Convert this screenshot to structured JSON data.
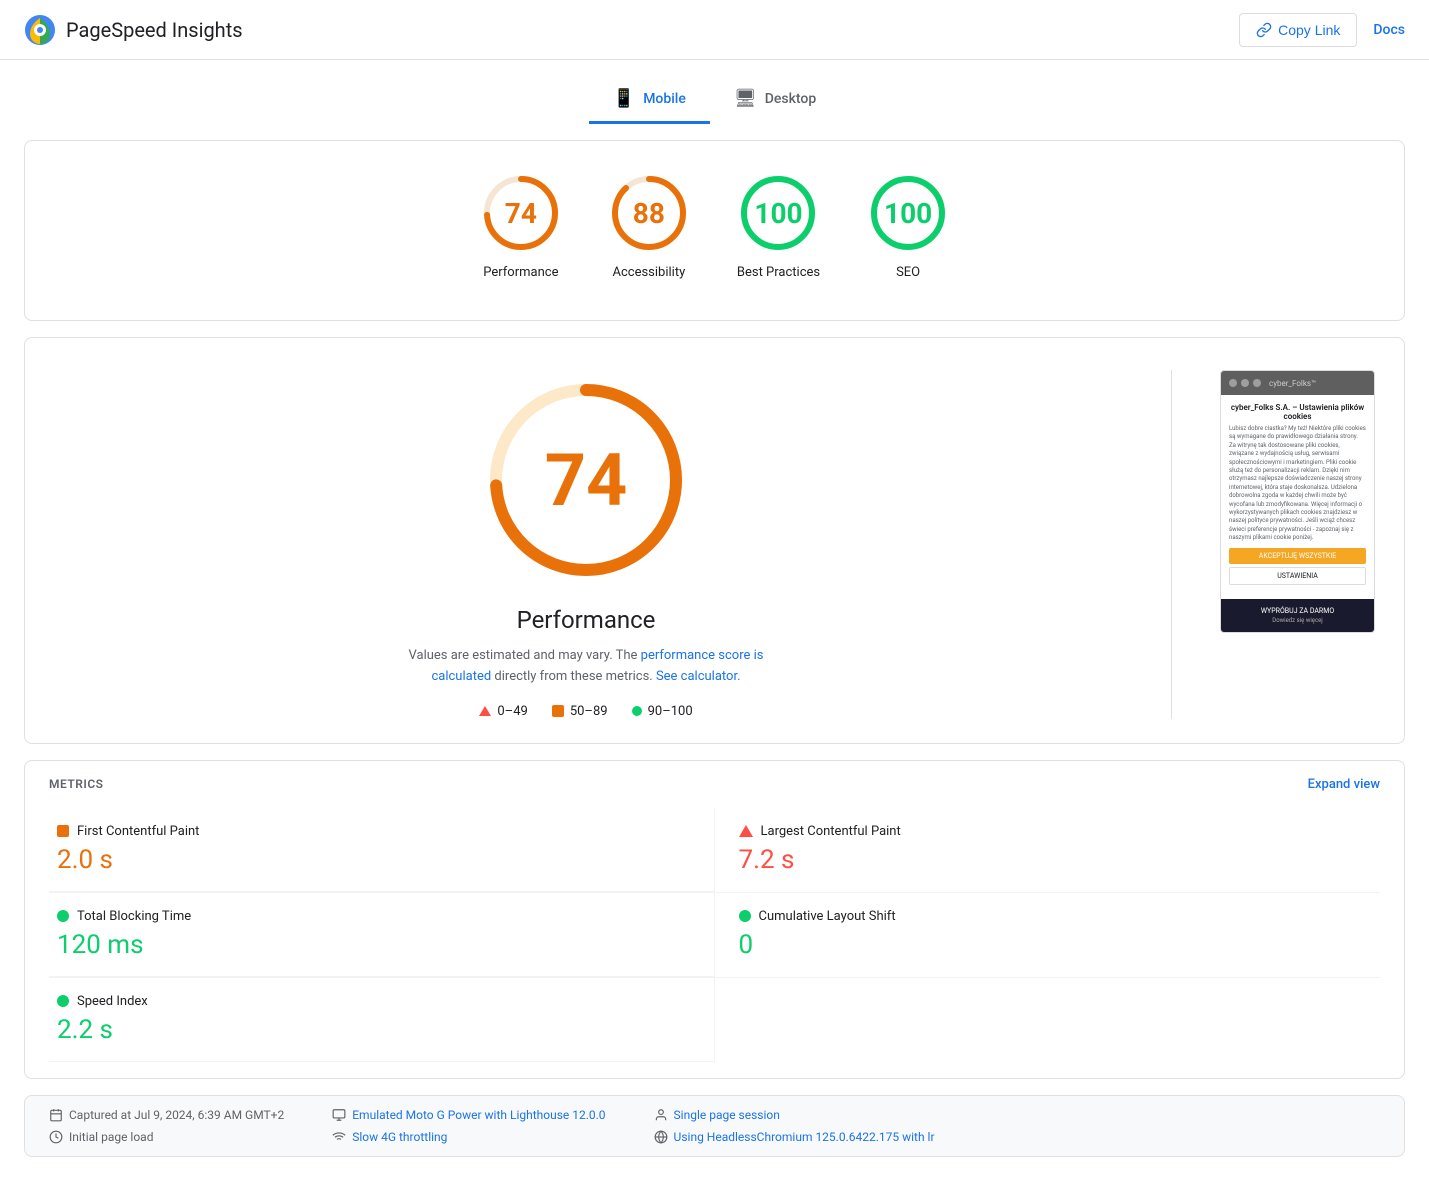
{
  "header": {
    "title": "PageSpeed Insights",
    "copy_link_label": "Copy Link",
    "docs_label": "Docs"
  },
  "tabs": {
    "mobile_label": "Mobile",
    "desktop_label": "Desktop"
  },
  "scores": [
    {
      "id": "performance",
      "value": 74,
      "label": "Performance",
      "color": "orange",
      "stroke": "#e8710a"
    },
    {
      "id": "accessibility",
      "value": 88,
      "label": "Accessibility",
      "color": "orange",
      "stroke": "#e8710a"
    },
    {
      "id": "best-practices",
      "value": 100,
      "label": "Best Practices",
      "color": "green",
      "stroke": "#0cce6b"
    },
    {
      "id": "seo",
      "value": 100,
      "label": "SEO",
      "color": "green",
      "stroke": "#0cce6b"
    }
  ],
  "performance": {
    "score": 74,
    "title": "Performance",
    "desc_text": "Values are estimated and may vary. The",
    "desc_link1": "performance score is calculated",
    "desc_mid": "directly from these metrics.",
    "desc_link2": "See calculator.",
    "legend": [
      {
        "type": "triangle",
        "range": "0–49"
      },
      {
        "type": "square",
        "color": "#e8710a",
        "range": "50–89"
      },
      {
        "type": "circle",
        "color": "#0cce6b",
        "range": "90–100"
      }
    ]
  },
  "screenshot": {
    "site_name": "cyber_Folks™",
    "title": "cyber_Folks S.A. – Ustawienia plików cookies",
    "body_text": "Lubisz dobre ciastka? My też! Niektóre pliki cookies są wymagane do prawidłowego działania strony. Za witrynę tak dostosowane pliki cookies, związane z wydajnością usług, serwisami społecznościowymi i marketingiem. Pliki cookie służą też do personalizacji reklam. Dzięki nim otrzymasz najlepsze doświadczenie naszej strony internetowej, która staje doskonalsza. Udzielona dobrowolna zgoda w każdej chwili może być wycofana lub zmodyfikowana. Więcej informacji o wykorzystywanych plikach cookies znajdziesz w naszej polityce prywatności. Jeśli wciąż chcesz świeci preferencje prywatności - zapoznaj się z naszymi plikami cookie poniżej.",
    "btn1": "AKCEPTUJĘ WSZYSTKIE",
    "btn2": "USTAWIENIA",
    "bottom_label": "WYPRÓBUJ ZA DARMO",
    "bottom_sub": "Dowiedz się więcej"
  },
  "metrics": {
    "section_title": "METRICS",
    "expand_label": "Expand view",
    "items": [
      {
        "id": "fcp",
        "name": "First Contentful Paint",
        "value": "2.0 s",
        "status": "orange",
        "indicator": "square"
      },
      {
        "id": "lcp",
        "name": "Largest Contentful Paint",
        "value": "7.2 s",
        "status": "red",
        "indicator": "triangle"
      },
      {
        "id": "tbt",
        "name": "Total Blocking Time",
        "value": "120 ms",
        "status": "green",
        "indicator": "circle"
      },
      {
        "id": "cls",
        "name": "Cumulative Layout Shift",
        "value": "0",
        "status": "green",
        "indicator": "circle"
      },
      {
        "id": "si",
        "name": "Speed Index",
        "value": "2.2 s",
        "status": "green",
        "indicator": "circle"
      }
    ]
  },
  "footer": {
    "captured": "Captured at Jul 9, 2024, 6:39 AM GMT+2",
    "initial_load": "Initial page load",
    "emulated": "Emulated Moto G Power with Lighthouse 12.0.0",
    "throttling": "Slow 4G throttling",
    "session": "Single page session",
    "browser": "Using HeadlessChromium 125.0.6422.175 with lr"
  }
}
